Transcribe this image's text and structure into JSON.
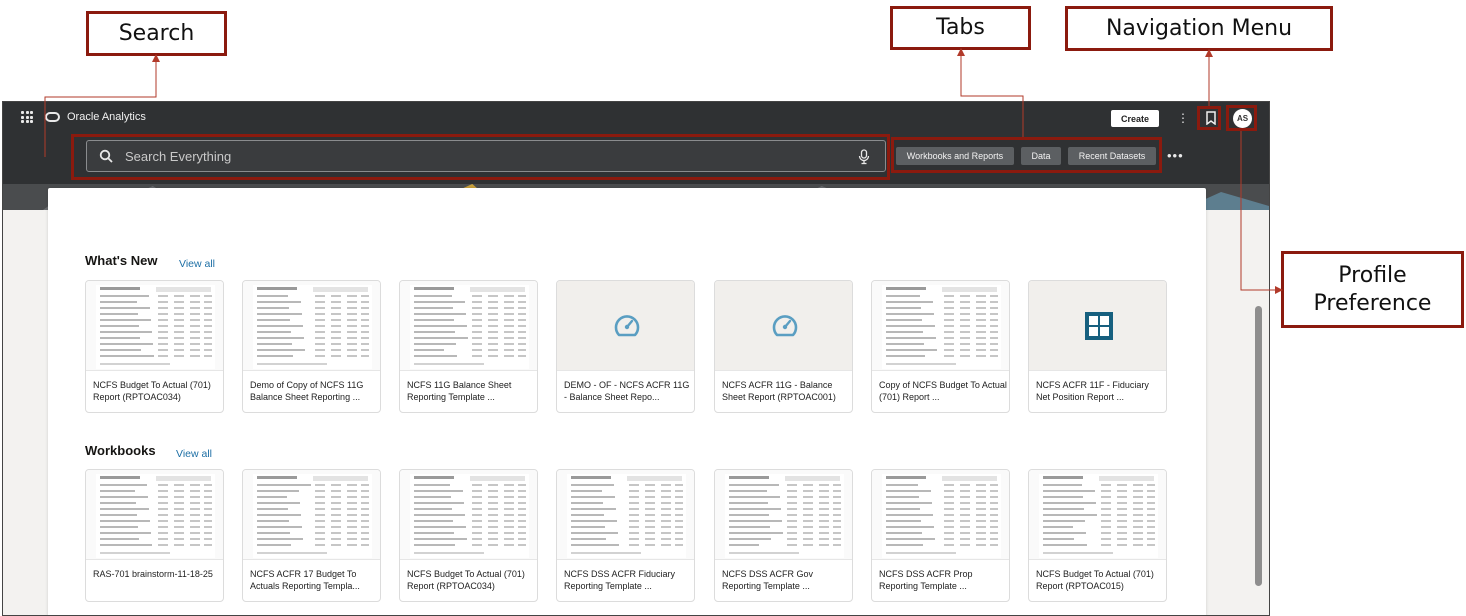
{
  "annotations": {
    "search": "Search",
    "tabs": "Tabs",
    "navigation_menu": "Navigation Menu",
    "profile_preference": "Profile Preference"
  },
  "app": {
    "title": "Oracle Analytics",
    "create_label": "Create",
    "avatar_initials": "AS",
    "search": {
      "placeholder": "Search Everything"
    },
    "tabs": [
      "Workbooks and Reports",
      "Data",
      "Recent Datasets"
    ]
  },
  "whats_new": {
    "title": "What's New",
    "view_all": "View all",
    "items": [
      {
        "title": "NCFS Budget To Actual (701) Report (RPTOAC034)",
        "thumb": "report"
      },
      {
        "title": "Demo of Copy of NCFS 11G Balance Sheet Reporting ...",
        "thumb": "report"
      },
      {
        "title": "NCFS 11G Balance Sheet Reporting Template ...",
        "thumb": "report"
      },
      {
        "title": "DEMO - OF - NCFS ACFR 11G - Balance Sheet Repo...",
        "thumb": "gauge-icon"
      },
      {
        "title": "NCFS ACFR 11G - Balance Sheet Report (RPTOAC001)",
        "thumb": "gauge-icon"
      },
      {
        "title": "Copy of NCFS Budget To Actual (701) Report ...",
        "thumb": "report"
      },
      {
        "title": "NCFS ACFR 11F - Fiduciary Net Position Report ...",
        "thumb": "grid-icon"
      }
    ]
  },
  "workbooks": {
    "title": "Workbooks",
    "view_all": "View all",
    "items": [
      {
        "title": "RAS-701 brainstorm-11-18-25"
      },
      {
        "title": "NCFS ACFR 17 Budget To Actuals Reporting Templa..."
      },
      {
        "title": "NCFS Budget To Actual (701) Report (RPTOAC034)"
      },
      {
        "title": "NCFS DSS ACFR Fiduciary Reporting Template ..."
      },
      {
        "title": "NCFS DSS ACFR Gov Reporting Template ..."
      },
      {
        "title": "NCFS DSS ACFR Prop Reporting Template ..."
      },
      {
        "title": "NCFS Budget To Actual (701) Report (RPTOAC015)"
      }
    ]
  },
  "colors": {
    "annotation": "#8b1a0e",
    "header_bg": "#2f3133",
    "accent_icon": "#5a9ec2",
    "grid_icon": "#17607f",
    "link": "#1d6fa5"
  }
}
